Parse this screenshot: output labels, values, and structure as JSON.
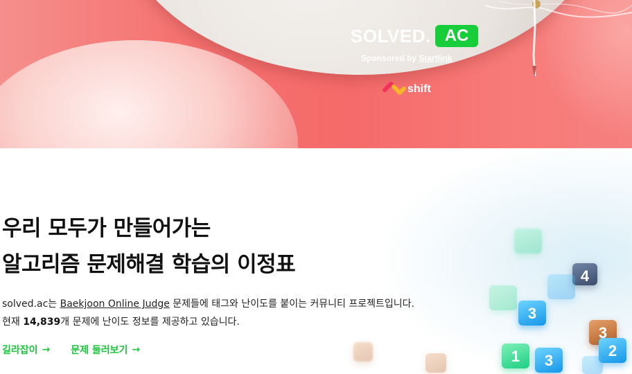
{
  "hero": {
    "brand_solved": "SOLVED.",
    "brand_ac": "AC",
    "sponsor_prefix": "Sponsored by ",
    "sponsor_link": "Startlink",
    "partner_name": "shift",
    "colors": {
      "background": "#f56a6a",
      "ac_badge": "#17ce3a"
    }
  },
  "main": {
    "headline_line1": "우리 모두가 만들어가는",
    "headline_line2": "알고리즘 문제해결 학습의 이정표",
    "desc_line1_prefix": "solved.ac는 ",
    "desc_line1_link": "Baekjoon Online Judge",
    "desc_line1_suffix": " 문제들에 태그와 난이도를 붙이는 커뮤니티 프로젝트입니다.",
    "desc_line2_prefix": "현재 ",
    "problem_count": "14,839",
    "desc_line2_suffix": "개 문제에 난이도 정보를 제공하고 있습니다.",
    "links": [
      {
        "label": "길라잡이",
        "icon": "arrow-right-icon"
      },
      {
        "label": "문제 둘러보기",
        "icon": "arrow-right-icon"
      }
    ],
    "link_color": "#1cc63b",
    "tier_badges": [
      {
        "tier": "green",
        "number": ""
      },
      {
        "tier": "navy",
        "number": "4"
      },
      {
        "tier": "blue",
        "number": ""
      },
      {
        "tier": "green",
        "number": ""
      },
      {
        "tier": "blue",
        "number": "3"
      },
      {
        "tier": "bronze",
        "number": "3"
      },
      {
        "tier": "blue",
        "number": "2"
      },
      {
        "tier": "green",
        "number": "1"
      },
      {
        "tier": "blue",
        "number": "3"
      },
      {
        "tier": "bronze",
        "number": ""
      },
      {
        "tier": "bronze",
        "number": ""
      },
      {
        "tier": "blue",
        "number": ""
      }
    ]
  }
}
